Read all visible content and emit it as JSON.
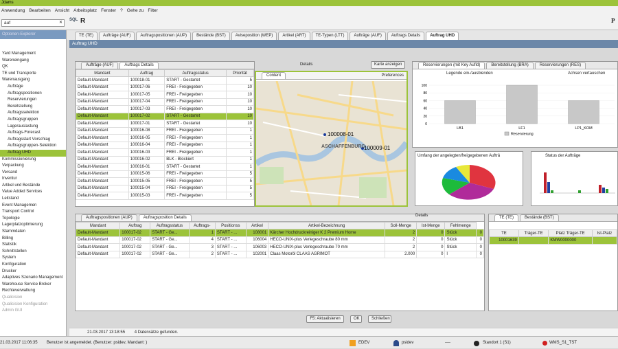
{
  "app": {
    "title": "Jdams"
  },
  "menu": [
    "Anwendung",
    "Bearbeiten",
    "Ansicht",
    "Arbeitsplatz",
    "Fenster",
    "?",
    "Gehe zu",
    "Filter"
  ],
  "search": {
    "value": "auf"
  },
  "sidebar": {
    "header": "Optionen-Explorer",
    "items": [
      {
        "label": "Yard Management"
      },
      {
        "label": "Wareneingang"
      },
      {
        "label": "QK"
      },
      {
        "label": "TE und Transporte"
      },
      {
        "label": "Warenausgang"
      },
      {
        "label": "Aufträge"
      },
      {
        "label": "Auftragspositionen"
      },
      {
        "label": "Reservierungen"
      },
      {
        "label": "Bereitstellung"
      },
      {
        "label": "Auftragsselektion"
      },
      {
        "label": "Auftragsgruppen"
      },
      {
        "label": "Lagerauslastung"
      },
      {
        "label": "Auftrags-Forecast"
      },
      {
        "label": "Auftragsstart Vorschlag"
      },
      {
        "label": "Auftragsgruppen-Selektion"
      },
      {
        "label": "Auftrag UHD"
      },
      {
        "label": "Kommissionierung"
      },
      {
        "label": "Verpackung"
      },
      {
        "label": "Versand"
      },
      {
        "label": "Inventur"
      },
      {
        "label": "Artikel und Bestände"
      },
      {
        "label": "Value Added Services"
      },
      {
        "label": "Leitstand"
      },
      {
        "label": "Event Managemen"
      },
      {
        "label": "Transport Control"
      },
      {
        "label": "Topologie"
      },
      {
        "label": "Lagerplatzoptimierung"
      },
      {
        "label": "Stammdaten"
      },
      {
        "label": "Billing"
      },
      {
        "label": "Statistik"
      },
      {
        "label": "Schnittstellen"
      },
      {
        "label": "System"
      },
      {
        "label": "Konfiguration"
      },
      {
        "label": "Drucker"
      },
      {
        "label": "Adaptives Szenario Management"
      },
      {
        "label": "Warehouse Service Broker"
      },
      {
        "label": "Rechteverwaltung"
      },
      {
        "label": "Qualicision"
      },
      {
        "label": "Qualicision Konfiguration"
      },
      {
        "label": "Admin GUI"
      }
    ]
  },
  "tabs": [
    "TE (TE)",
    "Aufträge (AUF)",
    "Auftragspositionen (AUP)",
    "Bestände (BST)",
    "Aviseposition (WEP)",
    "Artikel (ART)",
    "TE-Typen (LTT)",
    "Aufträge (AUF)",
    "Auftrags Details",
    "Auftrag UHD"
  ],
  "window": {
    "title": "Auftrag UHD"
  },
  "orders": {
    "tabs": [
      "Aufträge (AUF)",
      "Auftrags Details"
    ],
    "details_label": "Details",
    "map_button": "Karte anzeigen",
    "columns": [
      "Mandant",
      "Auftrag",
      "Auftragsstatus",
      "Priorität"
    ],
    "rows": [
      [
        "Default-Mandant",
        "100018-01",
        "START - Gestartet",
        "5"
      ],
      [
        "Default-Mandant",
        "100017-06",
        "FREI - Freigegeben",
        "10"
      ],
      [
        "Default-Mandant",
        "100017-05",
        "FREI - Freigegeben",
        "10"
      ],
      [
        "Default-Mandant",
        "100017-04",
        "FREI - Freigegeben",
        "10"
      ],
      [
        "Default-Mandant",
        "100017-03",
        "FREI - Freigegeben",
        "10"
      ],
      [
        "Default-Mandant",
        "100017-02",
        "START - Gestartet",
        "10"
      ],
      [
        "Default-Mandant",
        "100017-01",
        "START - Gestartet",
        "10"
      ],
      [
        "Default-Mandant",
        "100016-08",
        "FREI - Freigegeben",
        "1"
      ],
      [
        "Default-Mandant",
        "100016-05",
        "FREI - Freigegeben",
        "1"
      ],
      [
        "Default-Mandant",
        "100016-04",
        "FREI - Freigegeben",
        "1"
      ],
      [
        "Default-Mandant",
        "100016-03",
        "FREI - Freigegeben",
        "1"
      ],
      [
        "Default-Mandant",
        "100016-02",
        "BLK - Blockiert",
        "1"
      ],
      [
        "Default-Mandant",
        "100016-01",
        "START - Gestartet",
        "1"
      ],
      [
        "Default-Mandant",
        "100015-06",
        "FREI - Freigegeben",
        "5"
      ],
      [
        "Default-Mandant",
        "100015-05",
        "FREI - Freigegeben",
        "5"
      ],
      [
        "Default-Mandant",
        "100015-04",
        "FREI - Freigegeben",
        "5"
      ],
      [
        "Default-Mandant",
        "100015-03",
        "FREI - Freigegeben",
        "5"
      ]
    ]
  },
  "map": {
    "tab": "Content",
    "preferences": "Preferences",
    "markers": [
      "100008-01",
      "100009-01"
    ],
    "city": "ASCHAFFENBURG"
  },
  "reservations": {
    "tabs": [
      "Reservierungen (mit Key AufId)",
      "Bereitstellung (BRA)",
      "Reservierungen (RES)"
    ],
    "legend_toggle": "Legende ein-/ausblenden",
    "swap_axes": "Achsen vertauschen",
    "legend": "Reservierung"
  },
  "chart_data": [
    {
      "type": "bar",
      "categories": [
        "LB1",
        "LF1",
        "LP1_KOM"
      ],
      "values": [
        60,
        100,
        60
      ],
      "yticks": [
        "100",
        "80",
        "60",
        "40",
        "20",
        "0"
      ],
      "legend": [
        "Reservierung"
      ]
    },
    {
      "type": "pie",
      "title": "Umfang der angelegten/freigegebenen Aufträ"
    },
    {
      "type": "bar",
      "title": "Status der Aufträge"
    }
  ],
  "positions": {
    "tabs": [
      "Auftragspositionen (AUP)",
      "Auftragsposition Details"
    ],
    "details_label": "Details",
    "columns": [
      "Mandant",
      "Auftrag",
      "Auftragsstatus",
      "Auftrags-",
      "Positionss",
      "Artikel",
      "Artikel-Bezeichnung",
      "Soll-Menge",
      "Ist-Menge",
      "Fehlmenge"
    ],
    "rows": [
      [
        "Default-Mandant",
        "100017-02",
        "START - Ge...",
        "1",
        "START - ...",
        "108001",
        "Kärcher Hochdruckreiniger K 2 Premium Home",
        "2",
        "0",
        "Stück",
        "0"
      ],
      [
        "Default-Mandant",
        "100017-02",
        "START - Ge...",
        "4",
        "START - ...",
        "106004",
        "HECO-UNIX-plus Verlegeschraube 80 mm",
        "2",
        "0",
        "Stück",
        "0"
      ],
      [
        "Default-Mandant",
        "100017-02",
        "START - Ge...",
        "3",
        "START - ...",
        "106003",
        "HECO-UNIX-plus Verlegeschraube 70 mm",
        "2",
        "0",
        "Stück",
        "0"
      ],
      [
        "Default-Mandant",
        "100017-02",
        "START - Ge...",
        "2",
        "START - ...",
        "102001",
        "Claas Motoröl CLAAS AGRIMOT",
        "2.000",
        "0",
        "l",
        "0"
      ]
    ]
  },
  "te": {
    "tabs": [
      "TE (TE)",
      "Bestände (BST)"
    ],
    "columns": [
      "TE",
      "Träger-TE",
      "Platz Träger-TE",
      "Ist-Platz"
    ],
    "rows": [
      [
        "10001639",
        "",
        "KMW0000000",
        ""
      ]
    ]
  },
  "buttons": {
    "refresh": "F5: Aktualisieren",
    "ok": "OK",
    "close": "Schließen"
  },
  "status_line": {
    "timestamp": "21.03.2017 13:18:55",
    "message": "4 Datensätze gefunden."
  },
  "statusbar": {
    "datetime": "21.03.2017 11:06:35",
    "login": "Benutzer ist angemeldet. (Benutzer: psidev, Mandant: )",
    "env": "EDEV",
    "user": "psidev",
    "dash": "----",
    "site": "Standort 1 (S1)",
    "wms": "WMS_S1_TST"
  }
}
